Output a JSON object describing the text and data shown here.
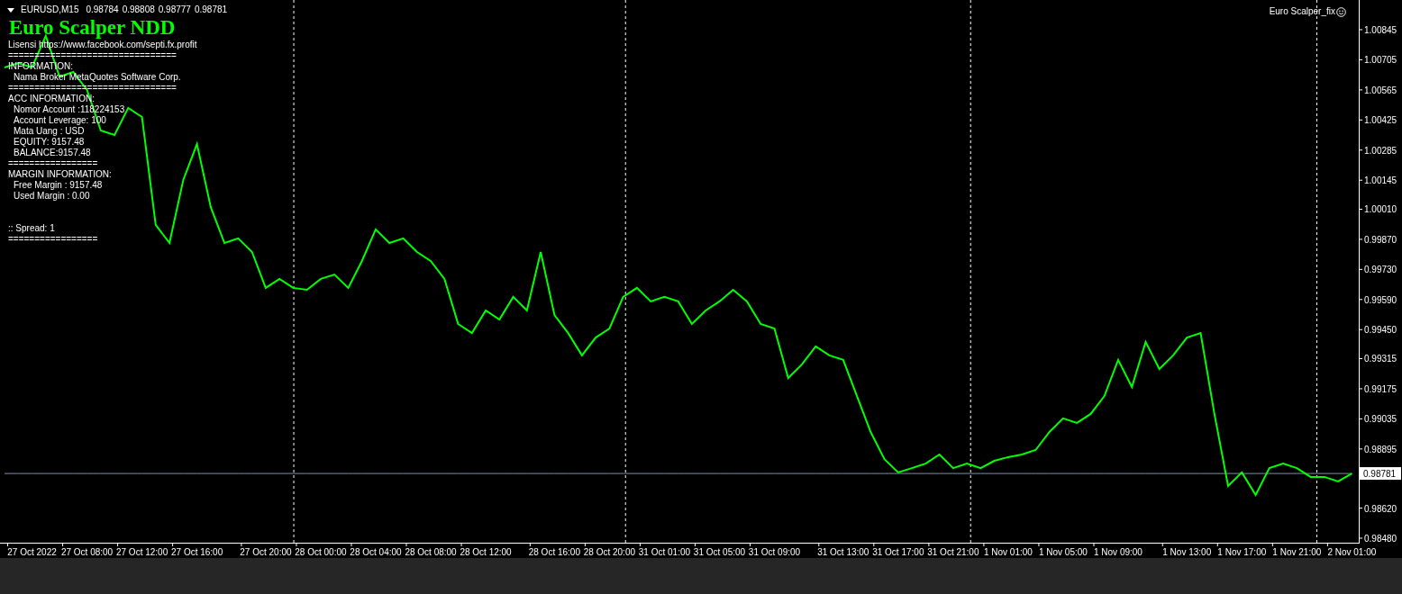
{
  "header": {
    "symbol": "EURUSD,M15",
    "ohlc": [
      "0.98784",
      "0.98808",
      "0.98777",
      "0.98781"
    ]
  },
  "indicator": {
    "title": "Euro Scalper NDD",
    "name": "Euro Scalper_fix",
    "lines": [
      {
        "text": "Lisensi https://www.facebook.com/septi.fx.profit",
        "indent": false,
        "gap_before": false
      },
      {
        "text": "================================",
        "indent": false,
        "gap_before": false
      },
      {
        "text": "INFORMATION:",
        "indent": false,
        "gap_before": false
      },
      {
        "text": "Nama Broker MetaQuotes Software Corp.",
        "indent": true,
        "gap_before": false
      },
      {
        "text": "================================",
        "indent": false,
        "gap_before": false
      },
      {
        "text": "ACC INFORMATION:",
        "indent": false,
        "gap_before": false
      },
      {
        "text": "Nomor Account :118224153",
        "indent": true,
        "gap_before": false
      },
      {
        "text": "Account Leverage: 100",
        "indent": true,
        "gap_before": false
      },
      {
        "text": "Mata Uang : USD",
        "indent": true,
        "gap_before": false
      },
      {
        "text": "EQUITY: 9157.48",
        "indent": true,
        "gap_before": false
      },
      {
        "text": "BALANCE:9157.48",
        "indent": true,
        "gap_before": false
      },
      {
        "text": "=================",
        "indent": false,
        "gap_before": false
      },
      {
        "text": "MARGIN INFORMATION:",
        "indent": false,
        "gap_before": false
      },
      {
        "text": "Free Margin : 9157.48",
        "indent": true,
        "gap_before": false
      },
      {
        "text": "Used Margin : 0.00",
        "indent": true,
        "gap_before": false
      },
      {
        "text": ":: Spread: 1",
        "indent": false,
        "gap_before": true
      },
      {
        "text": "=================",
        "indent": false,
        "gap_before": false
      }
    ]
  },
  "chart": {
    "bid_label": "0.98781",
    "chart_data": {
      "type": "line",
      "ylim": [
        0.98459,
        1.00983
      ],
      "categories": [
        null,
        null,
        "27 Oct 2022",
        null,
        null,
        null,
        "27 Oct 08:00",
        null,
        null,
        null,
        "27 Oct 12:00",
        null,
        null,
        null,
        "27 Oct 16:00",
        null,
        null,
        null,
        null,
        "27 Oct 20:00",
        null,
        null,
        null,
        "28 Oct 00:00",
        null,
        null,
        null,
        "28 Oct 04:00",
        null,
        null,
        null,
        "28 Oct 08:00",
        null,
        null,
        null,
        "28 Oct 12:00",
        null,
        null,
        null,
        null,
        "28 Oct 16:00",
        null,
        null,
        null,
        "28 Oct 20:00",
        null,
        null,
        null,
        "31 Oct 01:00",
        null,
        null,
        null,
        "31 Oct 05:00",
        null,
        null,
        null,
        "31 Oct 09:00",
        null,
        null,
        null,
        null,
        "31 Oct 13:00",
        null,
        null,
        null,
        "31 Oct 17:00",
        null,
        null,
        null,
        "31 Oct 21:00",
        null,
        null,
        null,
        "1 Nov 01:00",
        null,
        null,
        null,
        "1 Nov 05:00",
        null,
        null,
        null,
        "1 Nov 09:00",
        null,
        null,
        null,
        null,
        "1 Nov 13:00",
        null,
        null,
        null,
        "1 Nov 17:00",
        null,
        null,
        null,
        "1 Nov 21:00",
        null,
        null,
        null,
        "2 Nov 01:00"
      ],
      "yticks": [
        1.00845,
        1.00705,
        1.00565,
        1.00425,
        1.00285,
        1.00145,
        {
          "value": 1.0001,
          "label": "1.00010"
        },
        {
          "value": 0.9987,
          "label": "0.99870"
        },
        {
          "value": 0.9973,
          "label": "0.99730"
        },
        {
          "value": 0.9959,
          "label": "0.99590"
        },
        {
          "value": 0.9945,
          "label": "0.99450"
        },
        0.99315,
        0.99175,
        0.99035,
        0.98895,
        {
          "value": 0.9862,
          "label": "0.98620"
        },
        {
          "value": 0.9848,
          "label": "0.98480"
        }
      ],
      "series": [
        {
          "color": "#00ff00",
          "values": [
            1.00669,
            1.0069,
            1.00669,
            1.00816,
            1.00627,
            1.00648,
            1.00565,
            1.00376,
            1.00355,
            1.00481,
            1.00439,
            0.99937,
            0.99853,
            1.00146,
            1.00313,
            1.0002,
            0.99853,
            0.99874,
            0.99811,
            0.99644,
            0.99686,
            0.99644,
            0.99635,
            0.99686,
            0.99706,
            0.99644,
            0.99769,
            0.99916,
            0.99853,
            0.99874,
            0.99811,
            0.99769,
            0.99686,
            0.99476,
            0.99434,
            0.99539,
            0.99497,
            0.99602,
            0.99539,
            0.99811,
            0.99518,
            0.99434,
            0.9933,
            0.99413,
            0.99455,
            0.99602,
            0.99644,
            0.99581,
            0.99602,
            0.99581,
            0.99476,
            0.99539,
            0.99581,
            0.99635,
            0.99581,
            0.99476,
            0.99455,
            0.99225,
            0.99288,
            0.99372,
            0.9933,
            0.99309,
            0.99141,
            0.98974,
            0.98848,
            0.98786,
            0.98806,
            0.98827,
            0.98869,
            0.98806,
            0.98827,
            0.98806,
            0.9884,
            0.98857,
            0.98869,
            0.9889,
            0.98974,
            0.99037,
            0.99016,
            0.99058,
            0.99141,
            0.99309,
            0.99183,
            0.99393,
            0.99267,
            0.9933,
            0.99413,
            0.99434,
            0.99058,
            0.98723,
            0.98786,
            0.98681,
            0.98806,
            0.98827,
            0.98806,
            0.98765,
            0.98765,
            0.98744,
            0.98781
          ]
        },
        {
          "color": "#7f8fa6",
          "values": [
            0.98781,
            0.98781,
            0.98781,
            0.98781,
            0.98781,
            0.98781,
            0.98781,
            0.98781,
            0.98781,
            0.98781,
            0.98781,
            0.98781,
            0.98781,
            0.98781,
            0.98781,
            0.98781,
            0.98781,
            0.98781,
            0.98781,
            0.98781,
            0.98781,
            0.98781,
            0.98781,
            0.98781,
            0.98781,
            0.98781,
            0.98781,
            0.98781,
            0.98781,
            0.98781,
            0.98781,
            0.98781,
            0.98781,
            0.98781,
            0.98781,
            0.98781,
            0.98781,
            0.98781,
            0.98781,
            0.98781,
            0.98781,
            0.98781,
            0.98781,
            0.98781,
            0.98781,
            0.98781,
            0.98781,
            0.98781,
            0.98781,
            0.98781,
            0.98781,
            0.98781,
            0.98781,
            0.98781,
            0.98781,
            0.98781,
            0.98781,
            0.98781,
            0.98781,
            0.98781,
            0.98781,
            0.98781,
            0.98781,
            0.98781,
            0.98781,
            0.98781,
            0.98781,
            0.98781,
            0.98781,
            0.98781,
            0.98781,
            0.98781,
            0.98781,
            0.98781,
            0.98781,
            0.98781,
            0.98781,
            0.98781,
            0.98781,
            0.98781,
            0.98781,
            0.98781,
            0.98781,
            0.98781,
            0.98781,
            0.98781,
            0.98781,
            0.98781,
            0.98781,
            0.98781,
            0.98781,
            0.98781,
            0.98781,
            0.98781,
            0.98781,
            0.98781,
            0.98781,
            0.98781,
            0.98781
          ]
        }
      ]
    }
  }
}
